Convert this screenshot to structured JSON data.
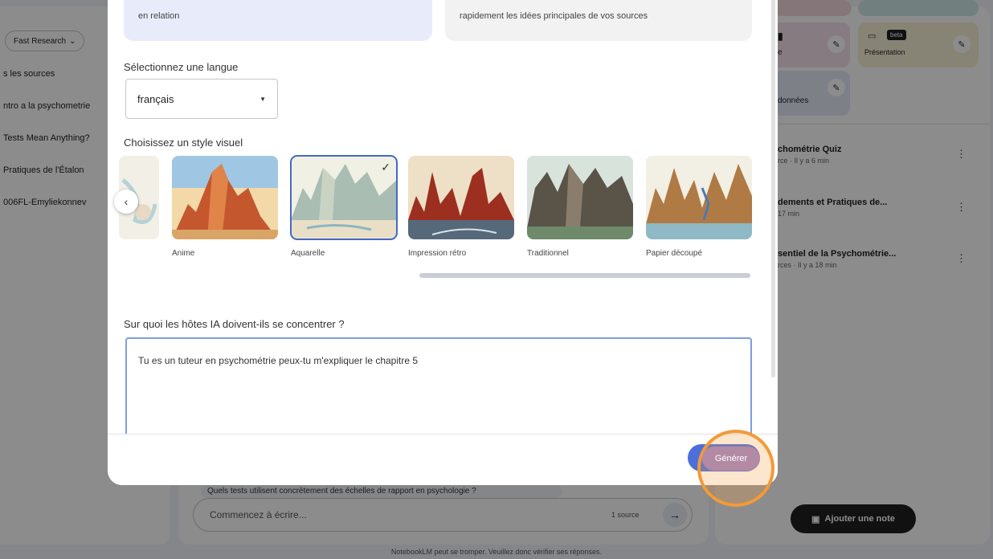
{
  "left_panel": {
    "research_label": "Fast Research",
    "sources": [
      "s les sources",
      "ntro a la psychometrie",
      "Tests Mean Anything?",
      "Pratiques de l'Étalon",
      "006FL-Emyliekonnev"
    ]
  },
  "right_panel": {
    "cards": {
      "presentation_label": "Présentation",
      "data_label": "données",
      "e_label": "e",
      "badge": "beta"
    },
    "notes": [
      {
        "title": "chométrie Quiz",
        "sub": "rce · Il y a 6 min"
      },
      {
        "title": "dements et Pratiques de...",
        "sub": "17 min"
      },
      {
        "title": "sentiel de la Psychométrie...",
        "sub": "rces · Il y a 18 min"
      }
    ],
    "add_note_label": "Ajouter une note"
  },
  "chat": {
    "suggestion": "Quels tests utilisent concrètement des échelles de rapport en psychologie ?",
    "placeholder": "Commencez à écrire...",
    "source_count": "1 source"
  },
  "footer_note": "NotebookLM peut se tromper. Veuillez donc vérifier ses réponses.",
  "modal": {
    "format_left_text": "en relation",
    "format_right_text": "rapidement les idées principales de vos sources",
    "language_label": "Sélectionnez une langue",
    "language_value": "français",
    "style_label": "Choisissez un style visuel",
    "styles": [
      {
        "name": "Anime"
      },
      {
        "name": "Aquarelle"
      },
      {
        "name": "Impression rétro"
      },
      {
        "name": "Traditionnel"
      },
      {
        "name": "Papier découpé"
      }
    ],
    "selected_style": "Aquarelle",
    "focus_label": "Sur quoi les hôtes IA doivent-ils se concentrer ?",
    "focus_value": "Tu es un tuteur en psychométrie peux-tu m'expliquer le chapitre 5",
    "generate_label": "Générer"
  },
  "colors": {
    "accent": "#4c6fdc",
    "highlight": "#f39a38"
  }
}
